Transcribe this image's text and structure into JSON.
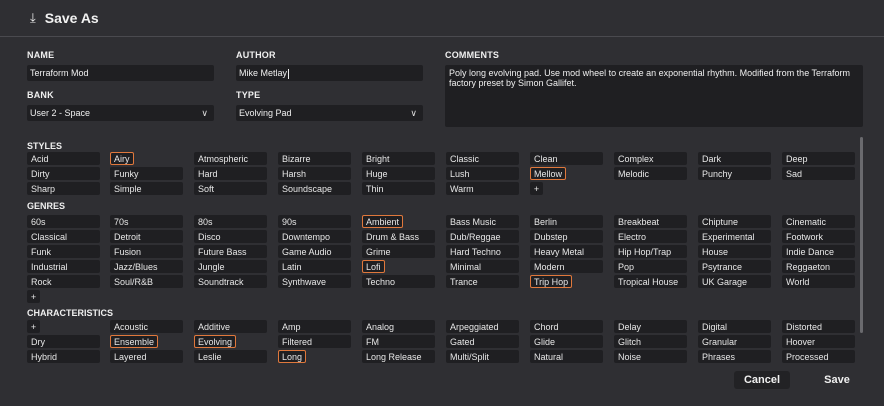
{
  "dialog": {
    "title": "Save As",
    "icon": "download-icon"
  },
  "fields": {
    "name": {
      "label": "NAME",
      "value": "Terraform Mod"
    },
    "author": {
      "label": "AUTHOR",
      "value": "Mike Metlay"
    },
    "bank": {
      "label": "BANK",
      "value": "User 2 - Space"
    },
    "type": {
      "label": "TYPE",
      "value": "Evolving Pad"
    },
    "comments": {
      "label": "COMMENTS",
      "value": "Poly long evolving pad. Use mod wheel to create an exponential rhythm. Modified from the Terraform factory preset by Simon Gallifet."
    }
  },
  "styles": {
    "label": "STYLES",
    "tags": [
      {
        "text": "Acid",
        "selected": false
      },
      {
        "text": "Airy",
        "selected": true
      },
      {
        "text": "Atmospheric",
        "selected": false
      },
      {
        "text": "Bizarre",
        "selected": false
      },
      {
        "text": "Bright",
        "selected": false
      },
      {
        "text": "Classic",
        "selected": false
      },
      {
        "text": "Clean",
        "selected": false
      },
      {
        "text": "Complex",
        "selected": false
      },
      {
        "text": "Dark",
        "selected": false
      },
      {
        "text": "Deep",
        "selected": false
      },
      {
        "text": "Dirty",
        "selected": false
      },
      {
        "text": "Funky",
        "selected": false
      },
      {
        "text": "Hard",
        "selected": false
      },
      {
        "text": "Harsh",
        "selected": false
      },
      {
        "text": "Huge",
        "selected": false
      },
      {
        "text": "Lush",
        "selected": false
      },
      {
        "text": "Mellow",
        "selected": true
      },
      {
        "text": "Melodic",
        "selected": false
      },
      {
        "text": "Punchy",
        "selected": false
      },
      {
        "text": "Sad",
        "selected": false
      },
      {
        "text": "Sharp",
        "selected": false
      },
      {
        "text": "Simple",
        "selected": false
      },
      {
        "text": "Soft",
        "selected": false
      },
      {
        "text": "Soundscape",
        "selected": false
      },
      {
        "text": "Thin",
        "selected": false
      },
      {
        "text": "Warm",
        "selected": false
      },
      {
        "text": "+",
        "selected": false
      }
    ]
  },
  "genres": {
    "label": "GENRES",
    "tags": [
      {
        "text": "60s",
        "selected": false
      },
      {
        "text": "70s",
        "selected": false
      },
      {
        "text": "80s",
        "selected": false
      },
      {
        "text": "90s",
        "selected": false
      },
      {
        "text": "Ambient",
        "selected": true
      },
      {
        "text": "Bass Music",
        "selected": false
      },
      {
        "text": "Berlin",
        "selected": false
      },
      {
        "text": "Breakbeat",
        "selected": false
      },
      {
        "text": "Chiptune",
        "selected": false
      },
      {
        "text": "Cinematic",
        "selected": false
      },
      {
        "text": "Classical",
        "selected": false
      },
      {
        "text": "Detroit",
        "selected": false
      },
      {
        "text": "Disco",
        "selected": false
      },
      {
        "text": "Downtempo",
        "selected": false
      },
      {
        "text": "Drum & Bass",
        "selected": false
      },
      {
        "text": "Dub/Reggae",
        "selected": false
      },
      {
        "text": "Dubstep",
        "selected": false
      },
      {
        "text": "Electro",
        "selected": false
      },
      {
        "text": "Experimental",
        "selected": false
      },
      {
        "text": "Footwork",
        "selected": false
      },
      {
        "text": "Funk",
        "selected": false
      },
      {
        "text": "Fusion",
        "selected": false
      },
      {
        "text": "Future Bass",
        "selected": false
      },
      {
        "text": "Game Audio",
        "selected": false
      },
      {
        "text": "Grime",
        "selected": false
      },
      {
        "text": "Hard Techno",
        "selected": false
      },
      {
        "text": "Heavy Metal",
        "selected": false
      },
      {
        "text": "Hip Hop/Trap",
        "selected": false
      },
      {
        "text": "House",
        "selected": false
      },
      {
        "text": "Indie Dance",
        "selected": false
      },
      {
        "text": "Industrial",
        "selected": false
      },
      {
        "text": "Jazz/Blues",
        "selected": false
      },
      {
        "text": "Jungle",
        "selected": false
      },
      {
        "text": "Latin",
        "selected": false
      },
      {
        "text": "Lofi",
        "selected": true
      },
      {
        "text": "Minimal",
        "selected": false
      },
      {
        "text": "Modern",
        "selected": false
      },
      {
        "text": "Pop",
        "selected": false
      },
      {
        "text": "Psytrance",
        "selected": false
      },
      {
        "text": "Reggaeton",
        "selected": false
      },
      {
        "text": "Rock",
        "selected": false
      },
      {
        "text": "Soul/R&B",
        "selected": false
      },
      {
        "text": "Soundtrack",
        "selected": false
      },
      {
        "text": "Synthwave",
        "selected": false
      },
      {
        "text": "Techno",
        "selected": false
      },
      {
        "text": "Trance",
        "selected": false
      },
      {
        "text": "Trip Hop",
        "selected": true
      },
      {
        "text": "Tropical House",
        "selected": false
      },
      {
        "text": "UK Garage",
        "selected": false
      },
      {
        "text": "World",
        "selected": false
      },
      {
        "text": "+",
        "selected": false
      }
    ]
  },
  "characteristics": {
    "label": "CHARACTERISTICS",
    "tags": [
      {
        "text": "+",
        "selected": false
      },
      {
        "text": "Acoustic",
        "selected": false
      },
      {
        "text": "Additive",
        "selected": false
      },
      {
        "text": "Amp",
        "selected": false
      },
      {
        "text": "Analog",
        "selected": false
      },
      {
        "text": "Arpeggiated",
        "selected": false
      },
      {
        "text": "Chord",
        "selected": false
      },
      {
        "text": "Delay",
        "selected": false
      },
      {
        "text": "Digital",
        "selected": false
      },
      {
        "text": "Distorted",
        "selected": false
      },
      {
        "text": "Dry",
        "selected": false
      },
      {
        "text": "Ensemble",
        "selected": true
      },
      {
        "text": "Evolving",
        "selected": true
      },
      {
        "text": "Filtered",
        "selected": false
      },
      {
        "text": "FM",
        "selected": false
      },
      {
        "text": "Gated",
        "selected": false
      },
      {
        "text": "Glide",
        "selected": false
      },
      {
        "text": "Glitch",
        "selected": false
      },
      {
        "text": "Granular",
        "selected": false
      },
      {
        "text": "Hoover",
        "selected": false
      },
      {
        "text": "Hybrid",
        "selected": false
      },
      {
        "text": "Layered",
        "selected": false
      },
      {
        "text": "Leslie",
        "selected": false
      },
      {
        "text": "Long",
        "selected": true
      },
      {
        "text": "Long Release",
        "selected": false
      },
      {
        "text": "Multi/Split",
        "selected": false
      },
      {
        "text": "Natural",
        "selected": false
      },
      {
        "text": "Noise",
        "selected": false
      },
      {
        "text": "Phrases",
        "selected": false
      },
      {
        "text": "Processed",
        "selected": false
      }
    ]
  },
  "buttons": {
    "cancel": "Cancel",
    "save": "Save"
  },
  "colors": {
    "accent": "#e0783c",
    "background": "#2f2f33",
    "field": "#1f1f22"
  }
}
